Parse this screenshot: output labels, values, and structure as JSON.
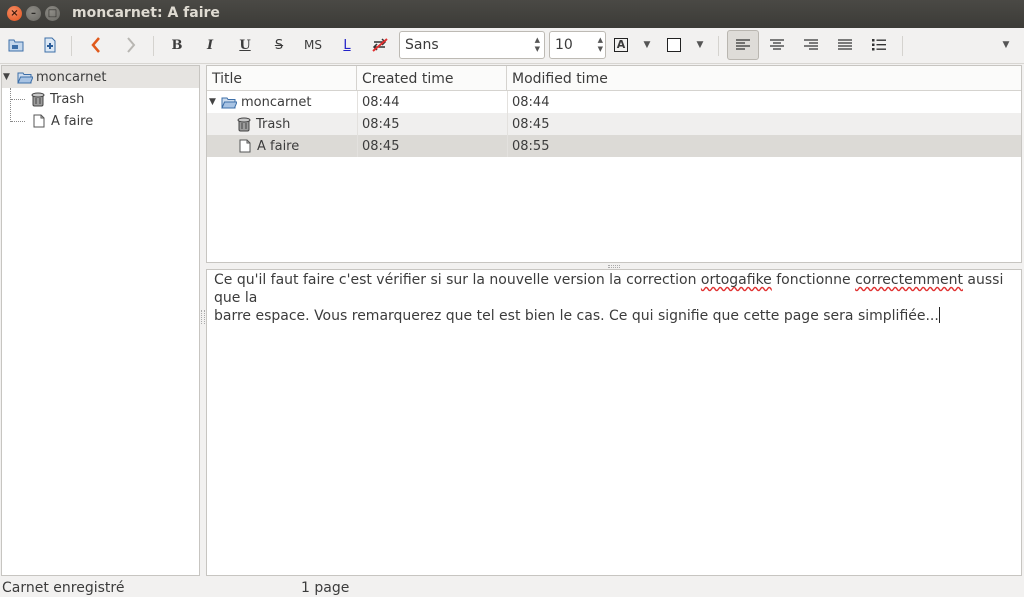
{
  "window": {
    "title": "moncarnet: A faire",
    "close_glyph": "×",
    "minimize_glyph": "–",
    "maximize_glyph": "□"
  },
  "toolbar": {
    "bold_label": "B",
    "italic_label": "I",
    "underline_label": "U",
    "strike_label": "S",
    "monospace_label": "MS",
    "link_label": "L",
    "font_family": "Sans",
    "font_size": "10",
    "text_color_label": "A"
  },
  "tree": {
    "items": [
      {
        "label": "moncarnet",
        "icon": "folder-open-icon"
      },
      {
        "label": "Trash",
        "icon": "trash-icon"
      },
      {
        "label": "A faire",
        "icon": "page-icon"
      }
    ]
  },
  "list": {
    "columns": [
      "Title",
      "Created time",
      "Modified time"
    ],
    "rows": [
      {
        "title": "moncarnet",
        "created": "08:44",
        "modified": "08:44",
        "icon": "folder-open-icon"
      },
      {
        "title": "Trash",
        "created": "08:45",
        "modified": "08:45",
        "icon": "trash-icon"
      },
      {
        "title": "A faire",
        "created": "08:45",
        "modified": "08:55",
        "icon": "page-icon"
      }
    ]
  },
  "editor": {
    "line1_a": "Ce qu'il faut faire c'est vérifier si sur la nouvelle version la correction ",
    "misspelled1": "ortogafike",
    "line1_b": " fonctionne ",
    "misspelled2": "correctemment",
    "line1_c": " aussi que la",
    "line2": "barre espace. Vous remarquerez que tel est bien le cas. Ce qui signifie que cette page sera simplifiée..."
  },
  "status": {
    "left": "Carnet enregistré",
    "middle": "1 page"
  },
  "colors": {
    "titlebar": "#3c3b37",
    "close_button": "#e2531d",
    "back_arrow": "#e05a1c",
    "spell_underline": "#e03030"
  }
}
